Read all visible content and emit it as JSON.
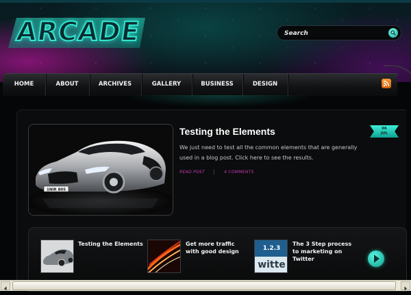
{
  "site": {
    "logo_text": "ARCADE"
  },
  "search": {
    "placeholder": "Search"
  },
  "nav": {
    "items": [
      {
        "label": "HOME"
      },
      {
        "label": "ABOUT"
      },
      {
        "label": "ARCHIVES"
      },
      {
        "label": "GALLERY"
      },
      {
        "label": "BUSINESS"
      },
      {
        "label": "DESIGN"
      }
    ],
    "rss_icon": "rss-icon"
  },
  "featured_post": {
    "title": "Testing the Elements",
    "excerpt": "We just need to test all the common elements that are generally used in a blog post. Click here to see the results.",
    "read_more": "READ POST",
    "separator": "|",
    "comments": "4 COMMENTS",
    "date_day": "06",
    "date_month": "JUL",
    "image_plate": "1NIR 805"
  },
  "slider": {
    "items": [
      {
        "title": "Testing the Elements",
        "thumb": "car"
      },
      {
        "title": "Get more traffic with good design",
        "thumb": "light-trails"
      },
      {
        "title": "The 3 Step process to marketing on Twitter",
        "thumb": "twitter",
        "thumb_text_top": "1.2.3",
        "thumb_text_bottom": "witte"
      }
    ],
    "next_icon": "arrow-right-icon"
  },
  "colors": {
    "accent": "#2ad9c0",
    "meta": "#c23bb1",
    "background": "#050607"
  }
}
